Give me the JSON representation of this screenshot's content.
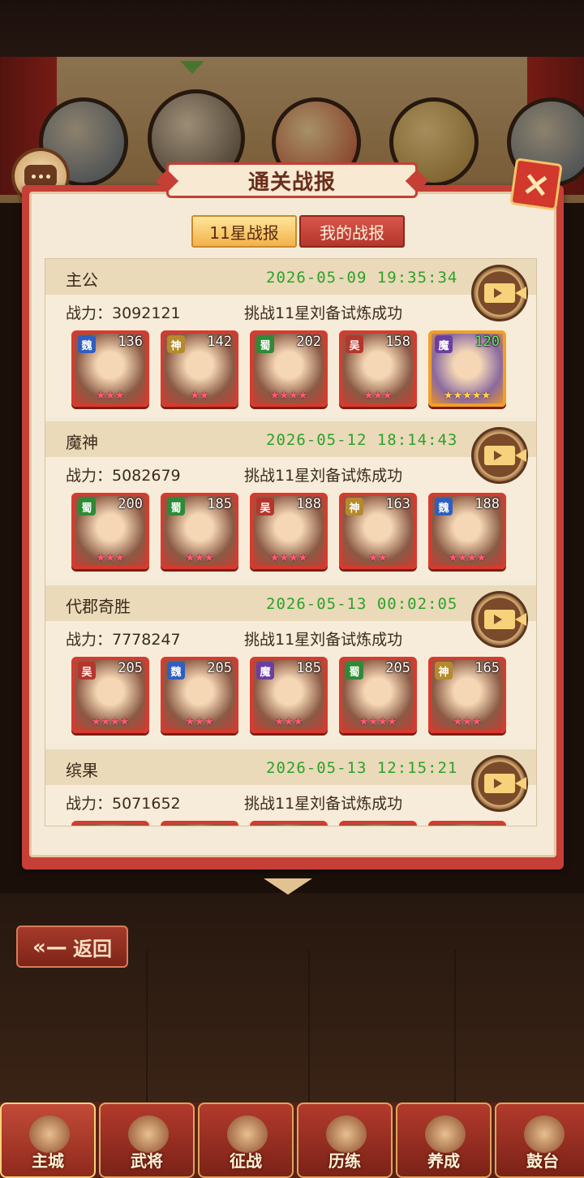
{
  "popup": {
    "title": "通关战报",
    "close_label": "×",
    "tabs": [
      {
        "label": "11星战报",
        "active": true
      },
      {
        "label": "我的战报",
        "active": false
      }
    ]
  },
  "reports": [
    {
      "name": "主公",
      "time": "2026-05-09 19:35:34",
      "power": "战力：3092121",
      "result": "挑战11星刘备试炼成功",
      "heroes": [
        {
          "faction": "魏",
          "level": "136",
          "stars": "★★★"
        },
        {
          "faction": "神",
          "level": "142",
          "stars": "★★"
        },
        {
          "faction": "蜀",
          "level": "202",
          "stars": "★★★★"
        },
        {
          "faction": "吴",
          "level": "158",
          "stars": "★★★"
        },
        {
          "faction": "魔",
          "level": "120",
          "stars": "★★★★★"
        }
      ]
    },
    {
      "name": "魔神",
      "time": "2026-05-12 18:14:43",
      "power": "战力：5082679",
      "result": "挑战11星刘备试炼成功",
      "heroes": [
        {
          "faction": "蜀",
          "level": "200",
          "stars": "★★★"
        },
        {
          "faction": "蜀",
          "level": "185",
          "stars": "★★★"
        },
        {
          "faction": "吴",
          "level": "188",
          "stars": "★★★★"
        },
        {
          "faction": "神",
          "level": "163",
          "stars": "★★"
        },
        {
          "faction": "魏",
          "level": "188",
          "stars": "★★★★"
        }
      ]
    },
    {
      "name": "代郡奇胜",
      "time": "2026-05-13 00:02:05",
      "power": "战力：7778247",
      "result": "挑战11星刘备试炼成功",
      "heroes": [
        {
          "faction": "吴",
          "level": "205",
          "stars": "★★★★"
        },
        {
          "faction": "魏",
          "level": "205",
          "stars": "★★★"
        },
        {
          "faction": "魔",
          "level": "185",
          "stars": "★★★"
        },
        {
          "faction": "蜀",
          "level": "205",
          "stars": "★★★★"
        },
        {
          "faction": "神",
          "level": "165",
          "stars": "★★★"
        }
      ]
    },
    {
      "name": "缤果",
      "time": "2026-05-13 12:15:21",
      "power": "战力：5071652",
      "result": "挑战11星刘备试炼成功",
      "heroes": []
    }
  ],
  "back_label": "返回",
  "back_arrow": "«—",
  "bottom_nav": [
    {
      "label": "主城",
      "active": true
    },
    {
      "label": "武将",
      "active": false
    },
    {
      "label": "征战",
      "active": false
    },
    {
      "label": "历练",
      "active": false
    },
    {
      "label": "养成",
      "active": false
    },
    {
      "label": "鼓台",
      "active": false
    }
  ]
}
